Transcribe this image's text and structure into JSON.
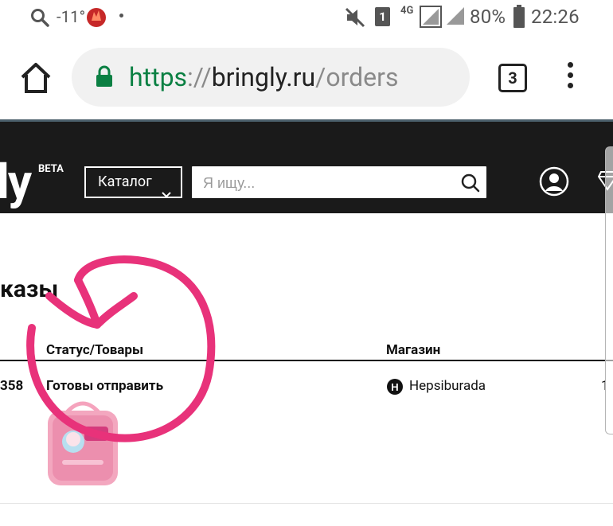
{
  "status_bar": {
    "temperature": "-11°",
    "battery_percent": "80%",
    "time": "22:26",
    "network_type": "4G",
    "sim_slot": "1"
  },
  "browser": {
    "url_scheme": "https",
    "url_separator": "://",
    "url_host": "bringly.ru",
    "url_path": "/orders",
    "tab_count": "3"
  },
  "site_header": {
    "logo": "ly",
    "beta_label": "BETA",
    "catalog_label": "Каталог",
    "search_placeholder": "Я ищу..."
  },
  "page": {
    "title": "казы",
    "columns": {
      "status": "Статус/Товары",
      "store": "Магазин",
      "last": ""
    },
    "order_row": {
      "order_number_fragment": "358",
      "status": "Готовы отправить",
      "store": "Hepsiburada",
      "store_badge": "H",
      "last_fragment": "1"
    }
  },
  "colors": {
    "header_bg": "#1a1a1a",
    "url_scheme": "#0b8043",
    "annotation": "#e8327a"
  }
}
